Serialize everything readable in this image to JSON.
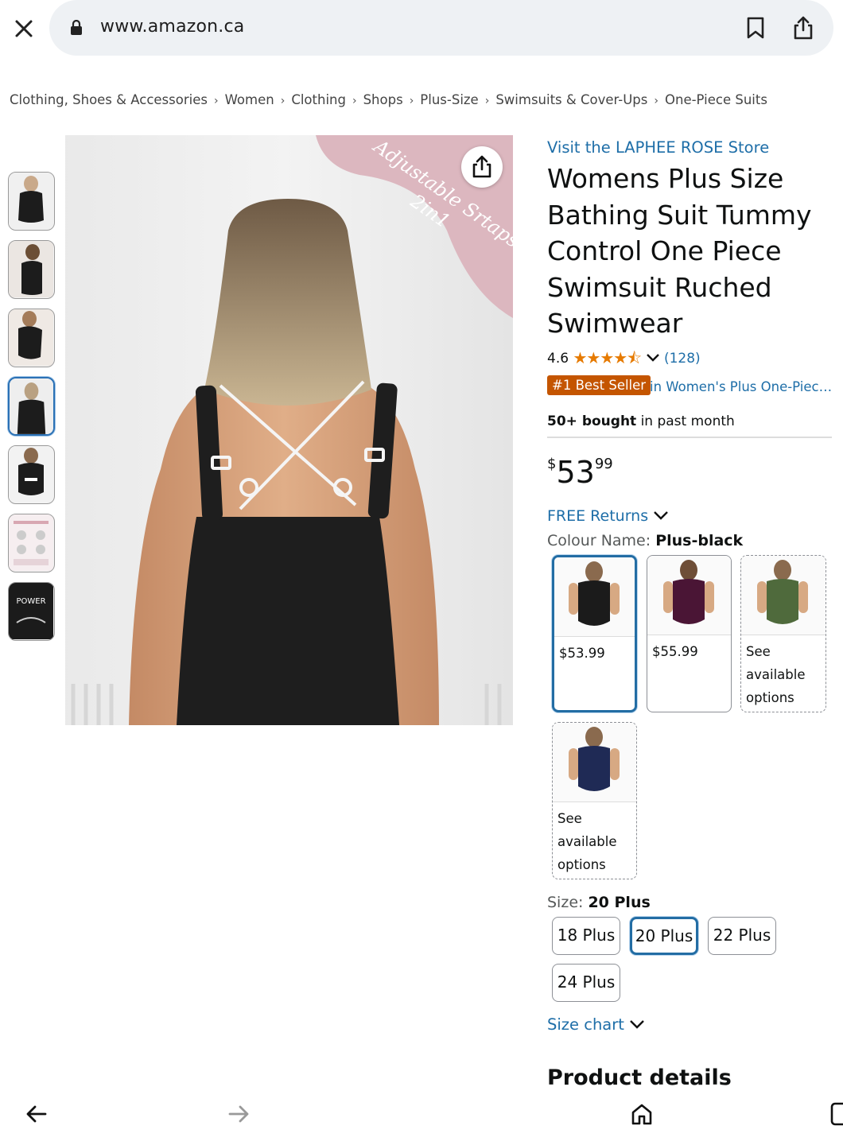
{
  "browser": {
    "url": "www.amazon.ca",
    "close_icon": "close-icon",
    "lock_icon": "lock-icon",
    "bookmark_icon": "bookmark-icon",
    "share_icon": "share-icon"
  },
  "breadcrumb": [
    "Clothing, Shoes & Accessories",
    "Women",
    "Clothing",
    "Shops",
    "Plus-Size",
    "Swimsuits & Cover-Ups",
    "One-Piece Suits"
  ],
  "gallery": {
    "thumbnails": [
      {
        "name": "thumb-1",
        "selected": false
      },
      {
        "name": "thumb-2",
        "selected": false
      },
      {
        "name": "thumb-3",
        "selected": false
      },
      {
        "name": "thumb-4",
        "selected": true
      },
      {
        "name": "thumb-5",
        "selected": false
      },
      {
        "name": "thumb-6",
        "selected": false
      },
      {
        "name": "thumb-7",
        "selected": false
      }
    ],
    "image_caption_line1": "Adjustable Srtaps",
    "image_caption_line2": "2in1",
    "thumb7_text": "POWER"
  },
  "product": {
    "store_link": "Visit the LAPHEE ROSE Store",
    "title": "Womens Plus Size Bathing Suit Tummy Control One Piece Swimsuit Ruched Swimwear",
    "rating": "4.6",
    "stars": "★★★★⯪",
    "rating_count": "(128)",
    "badge": "#1 Best Seller",
    "badge_category": "in Women's Plus One-Piece Swimsuits",
    "bought_bold": "50+ bought",
    "bought_rest": " in past month",
    "price_symbol": "$",
    "price_whole": "53",
    "price_fraction": "99",
    "free_returns": "FREE Returns",
    "colour_label": "Colour Name: ",
    "colour_value": "Plus-black",
    "swatches": [
      {
        "label": "$53.99",
        "color": "#1b1b1b",
        "selected": true
      },
      {
        "label": "$55.99",
        "color": "#4a1535",
        "selected": false
      },
      {
        "label": "See available options",
        "color": "#4f6a3c",
        "selected": false
      },
      {
        "label": "See available options",
        "color": "#1f2a55",
        "selected": false
      }
    ],
    "size_label": "Size: ",
    "size_value": "20 Plus",
    "sizes": [
      "18 Plus",
      "20 Plus",
      "22 Plus",
      "24 Plus"
    ],
    "size_chart": "Size chart",
    "product_details": "Product details"
  },
  "nav": {
    "back_icon": "arrow-left-icon",
    "forward_icon": "arrow-right-icon",
    "home_icon": "home-icon",
    "tabs_icon": "tabs-icon"
  },
  "colors": {
    "link": "#1e6ea8",
    "badge": "#c45500",
    "selected_border": "#236da4",
    "star": "#e67a00"
  }
}
